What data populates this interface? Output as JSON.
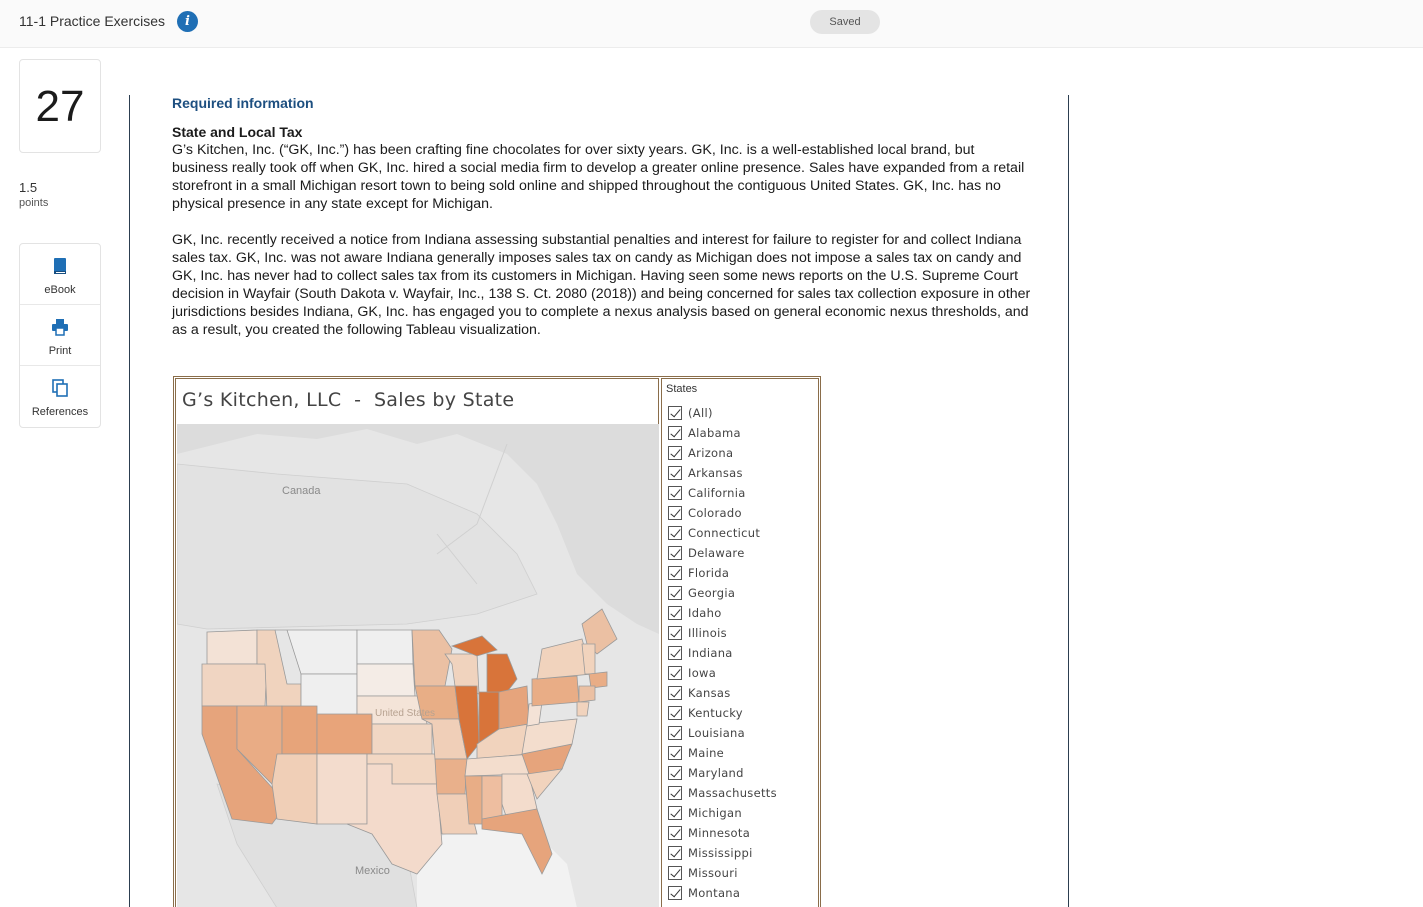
{
  "header": {
    "title": "11-1 Practice Exercises",
    "saved_label": "Saved"
  },
  "question": {
    "number": "27",
    "points_value": "1.5",
    "points_label": "points"
  },
  "tools": [
    {
      "label": "eBook",
      "icon": "book-icon"
    },
    {
      "label": "Print",
      "icon": "printer-icon"
    },
    {
      "label": "References",
      "icon": "copy-icon"
    }
  ],
  "content": {
    "required_info": "Required information",
    "subheading": "State and Local Tax",
    "paragraph1": "G’s Kitchen, Inc. (“GK, Inc.”) has been crafting fine chocolates for over sixty years. GK, Inc. is a well-established local brand, but business really took off when GK, Inc. hired a social media firm to develop a greater online presence. Sales have expanded from a retail storefront in a small Michigan resort town to being sold online and shipped throughout the contiguous United States. GK, Inc. has no physical presence in any state except for Michigan.",
    "paragraph2": "GK, Inc. recently received a notice from Indiana assessing substantial penalties and interest for failure to register for and collect Indiana sales tax. GK, Inc. was not aware Indiana generally imposes sales tax on candy as Michigan does not impose a sales tax on candy and GK, Inc. has never had to collect sales tax from its customers in Michigan. Having seen some news reports on the U.S. Supreme Court decision in Wayfair (South Dakota v. Wayfair, Inc., 138 S. Ct. 2080 (2018)) and being concerned for sales tax collection exposure in other jurisdictions besides Indiana, GK, Inc. has engaged you to complete a nexus analysis based on general economic nexus thresholds, and as a result, you created the following Tableau visualization."
  },
  "viz": {
    "title": "G’s Kitchen, LLC  -  Sales by State",
    "map_labels": {
      "canada": "Canada",
      "us": "United States",
      "mexico": "Mexico"
    },
    "filter_title": "States",
    "states": [
      "(All)",
      "Alabama",
      "Arizona",
      "Arkansas",
      "California",
      "Colorado",
      "Connecticut",
      "Delaware",
      "Florida",
      "Georgia",
      "Idaho",
      "Illinois",
      "Indiana",
      "Iowa",
      "Kansas",
      "Kentucky",
      "Louisiana",
      "Maine",
      "Maryland",
      "Massachusetts",
      "Michigan",
      "Minnesota",
      "Mississippi",
      "Missouri",
      "Montana"
    ],
    "colors": {
      "high": "#d8743a",
      "mid": "#e9a77c",
      "low": "#f3d2bb",
      "none": "#efefef"
    }
  }
}
